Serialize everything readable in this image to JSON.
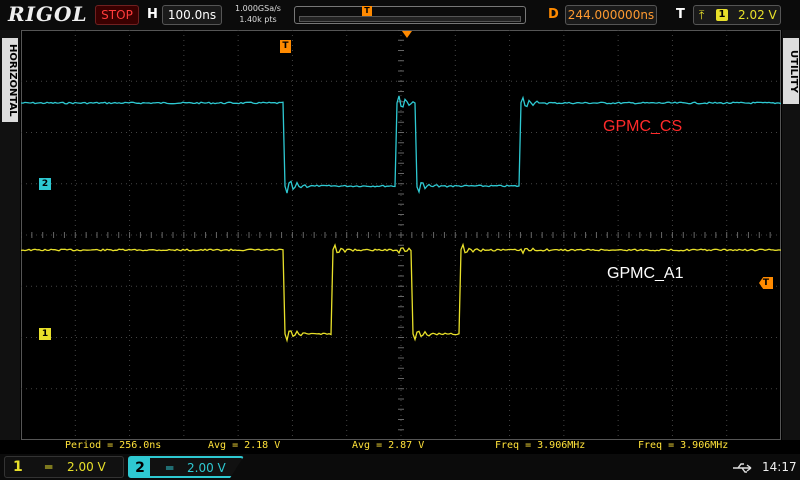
{
  "header": {
    "brand": "RIGOL",
    "run_state": "STOP",
    "timebase_label": "H",
    "timebase_value": "100.0ns",
    "sample_rate": "1.000GSa/s",
    "memory_depth": "1.40k pts",
    "trigger_pos_marker": "T",
    "delay_label": "D",
    "delay_value": "244.000000ns",
    "trigger_label": "T",
    "trigger_channel": "1",
    "trigger_level": "2.02 V"
  },
  "side": {
    "left_tab": "HORIZONTAL",
    "right_tab": "UTILITY"
  },
  "markers": {
    "ch2": "2",
    "ch1": "1",
    "trigger_top": "T",
    "trigger_right": "T"
  },
  "annotations": {
    "cs": "GPMC_CS",
    "a1": "GPMC_A1"
  },
  "measurements": {
    "m1": "Period = 256.0ns",
    "m2": "Avg = 2.18 V",
    "m3": "Avg = 2.87 V",
    "m4": "Freq = 3.906MHz",
    "m5": "Freq = 3.906MHz"
  },
  "footer": {
    "ch1_num": "1",
    "ch1_coupling": "═",
    "ch1_scale": "2.00 V",
    "ch2_num": "2",
    "ch2_coupling": "═",
    "ch2_scale": "2.00 V",
    "clock": "14:17"
  },
  "colors": {
    "ch1": "#e8e02a",
    "ch2": "#2ec9d2",
    "cs_label": "#ff2a2a",
    "a1_label": "#ffffff",
    "trigger": "#ff8a00"
  }
}
